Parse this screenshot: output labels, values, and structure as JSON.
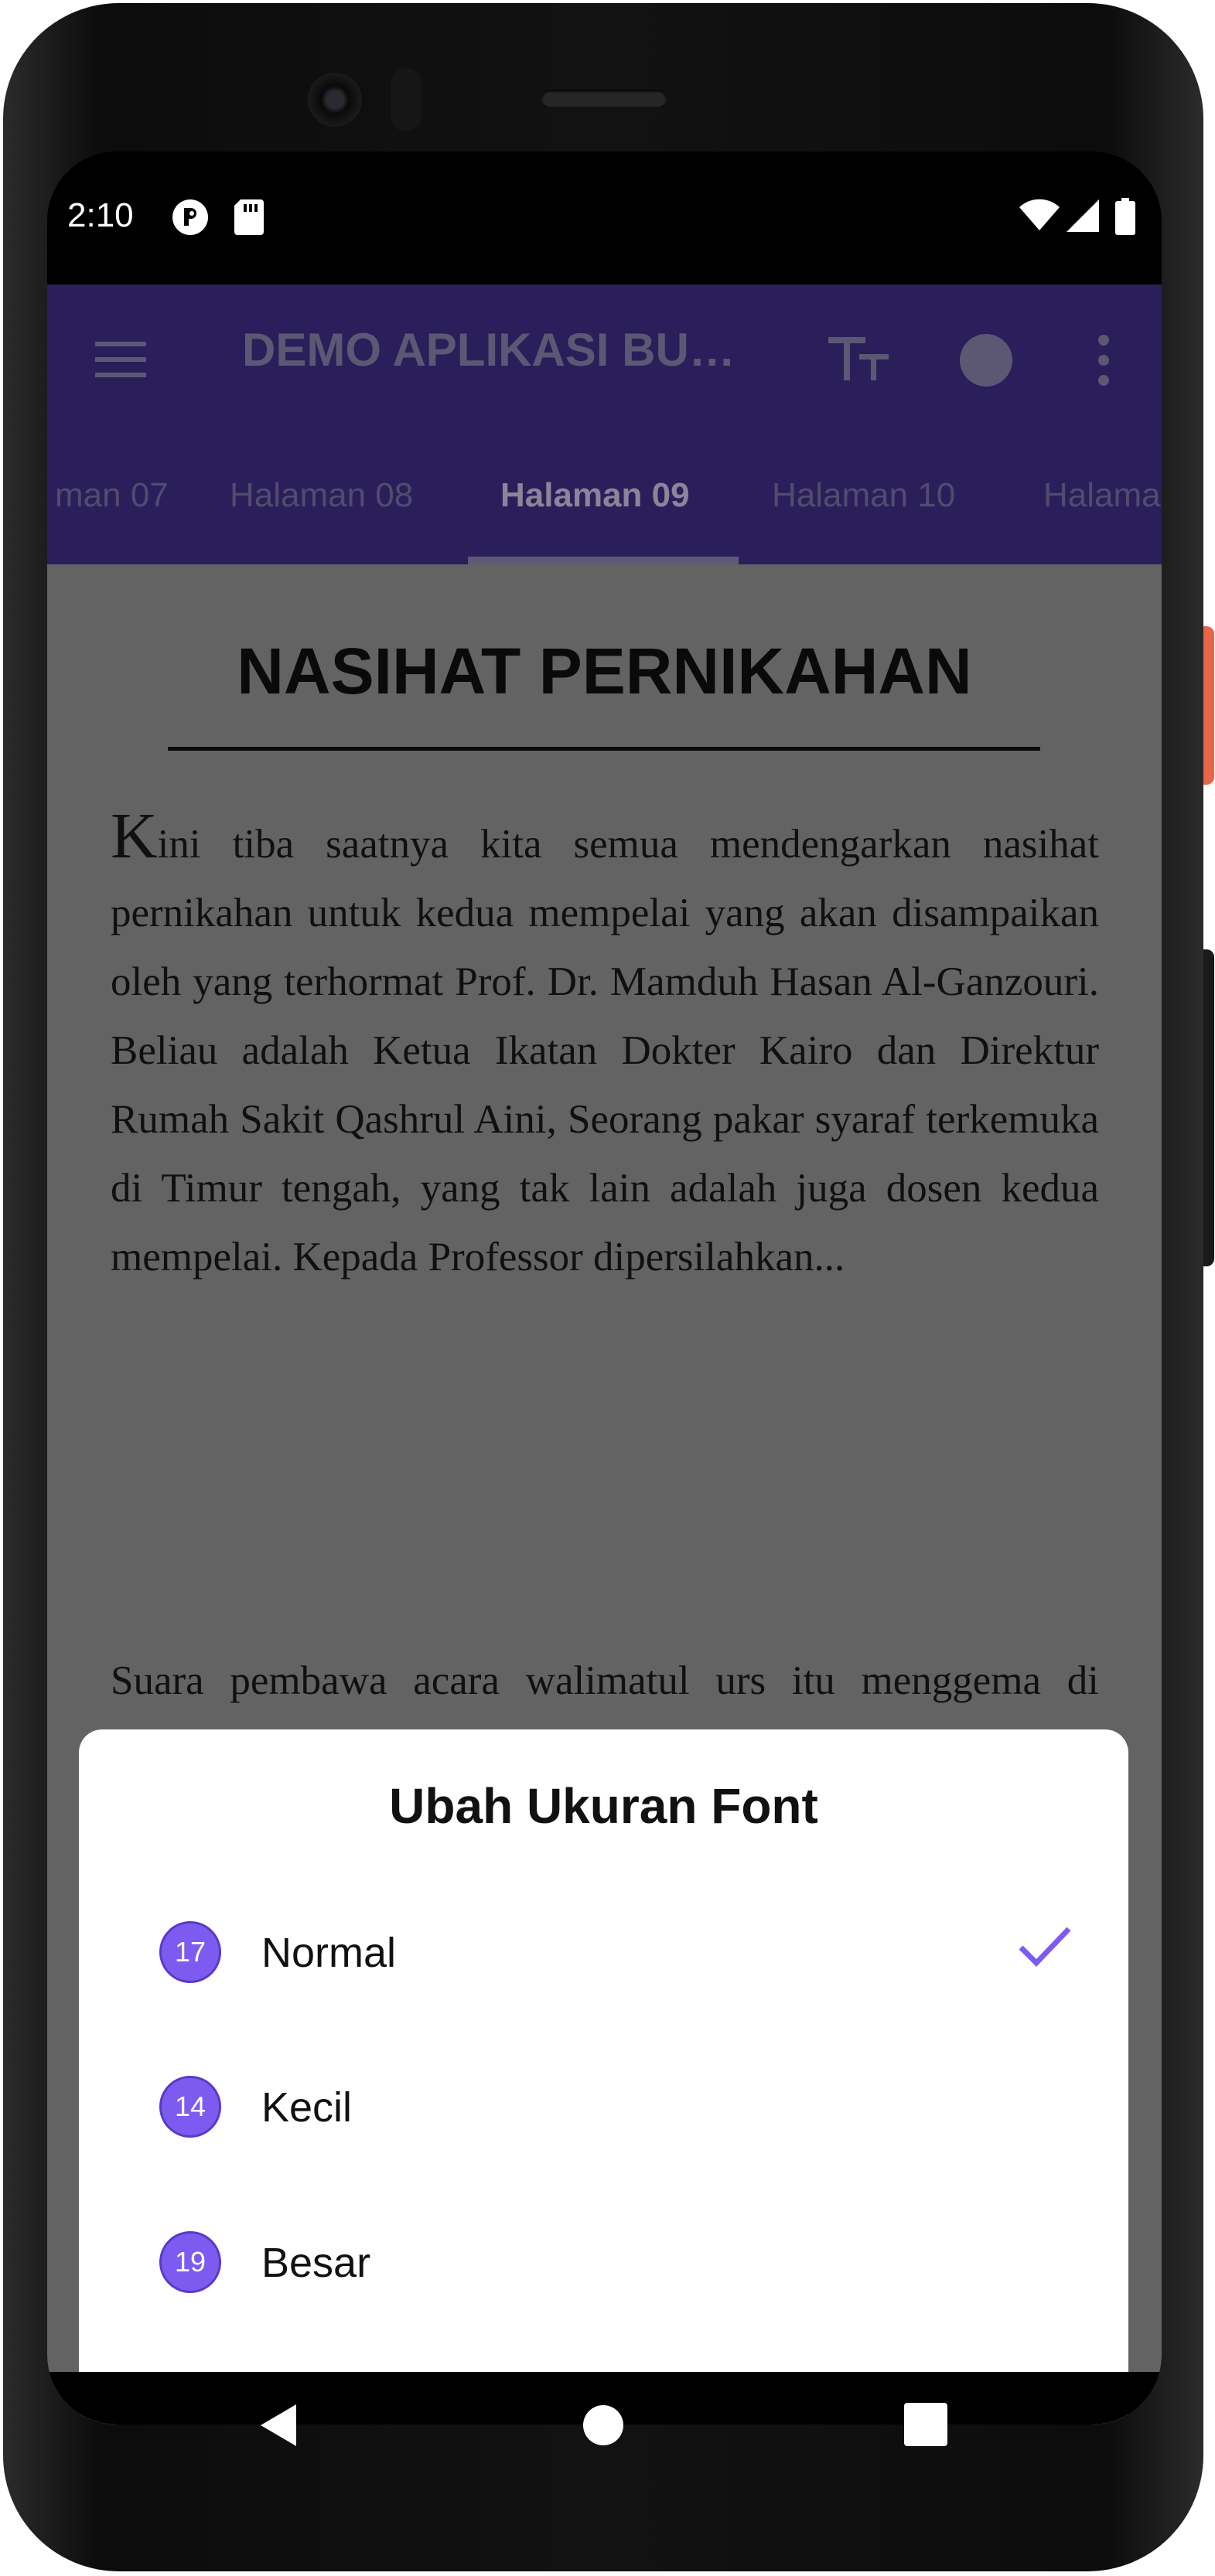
{
  "status_bar": {
    "time": "2:10",
    "left_icons": [
      "cast-media-icon",
      "sd-card-icon"
    ],
    "right_icons": [
      "wifi-icon",
      "cellular-signal-icon",
      "battery-icon"
    ]
  },
  "app_bar": {
    "menu_icon": "menu-icon",
    "title": "DEMO APLIKASI BU…",
    "actions": [
      "text-size-icon",
      "theme-circle-icon",
      "more-vertical-icon"
    ]
  },
  "tabs": [
    {
      "label": "man 07",
      "active": false
    },
    {
      "label": "Halaman 08",
      "active": false
    },
    {
      "label": "Halaman 09",
      "active": true
    },
    {
      "label": "Halaman 10",
      "active": false
    },
    {
      "label": "Halama",
      "active": false
    }
  ],
  "article": {
    "heading": "NASIHAT PERNIKAHAN",
    "p1_dropcap": "K",
    "p1_rest": "ini tiba saatnya kita semua mendengarkan nasihat pernikahan untuk kedua mempelai yang akan disampaikan oleh yang terhormat Prof. Dr. Mamduh Hasan Al-Ganzouri. Beliau adalah Ketua Ikatan Dokter Kairo dan Direktur Rumah Sakit Qashrul Aini, Seorang pakar syaraf terkemuka di Timur tengah, yang tak lain adalah juga dosen kedua mempelai. Kepada Professor dipersilahkan...",
    "p2": "Suara pembawa acara walimatul urs itu menggema di seluruh ruangan resepsi pernikahan nan mewah di Hotel Hilton Ramses yang terletak di tepi sungai Nil, Kairo. Seluruh"
  },
  "font_sheet": {
    "title": "Ubah Ukuran Font",
    "options": [
      {
        "size": "17",
        "label": "Normal",
        "selected": true
      },
      {
        "size": "14",
        "label": "Kecil",
        "selected": false
      },
      {
        "size": "19",
        "label": "Besar",
        "selected": false
      }
    ],
    "accent_color": "#7d5bf0"
  },
  "nav_bar": {
    "icons": [
      "back-icon",
      "home-icon",
      "recents-icon"
    ]
  }
}
